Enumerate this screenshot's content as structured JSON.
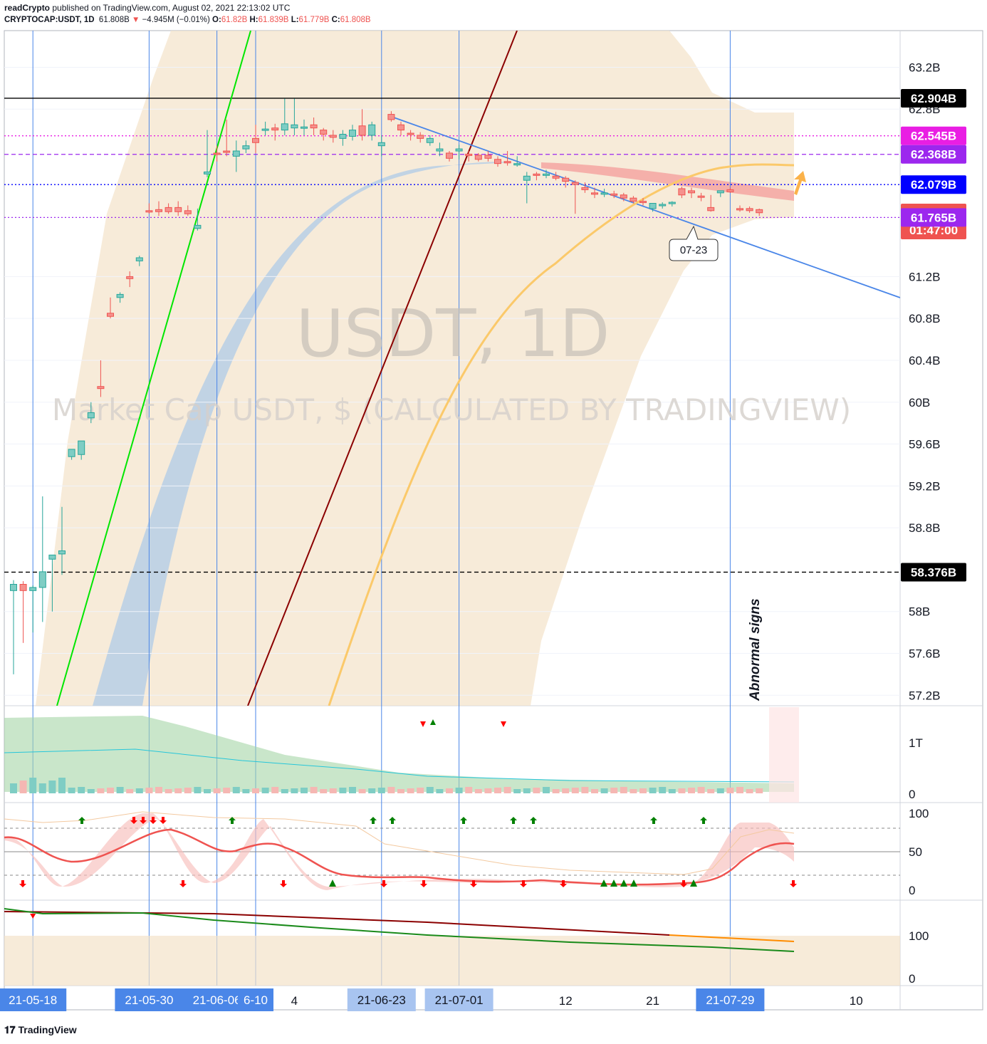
{
  "header": {
    "publisher": "readCrypto",
    "published_text": "published on TradingView.com, August 02, 2021 22:13:02 UTC",
    "symbol": "CRYPTOCAP:USDT, 1D",
    "last": "61.808B",
    "change_arrow": "▼",
    "change": "−4.945M (−0.01%)",
    "o_label": "O:",
    "o": "61.82B",
    "h_label": "H:",
    "h": "61.839B",
    "l_label": "L:",
    "l": "61.779B",
    "c_label": "C:",
    "c": "61.808B"
  },
  "watermark": {
    "main": "USDT, 1D",
    "sub": "Market Cap USDT, $ (CALCULATED BY TRADINGVIEW)"
  },
  "annotations": {
    "callout": "07-23",
    "vertical_text": "Abnormal signs"
  },
  "footer": {
    "brand": "TradingView"
  },
  "colors": {
    "up": "#26a69a",
    "down": "#ef5350",
    "trend_blue": "#4a86e8",
    "green_line": "#00e600",
    "dark_red_line": "#8b0000",
    "orange_ma": "#fbc96a",
    "cloud": "#f3e2c9",
    "blue_band": "#b3cde6",
    "magenta": "#e91ee3",
    "purple": "#9c27ee",
    "blue_label": "#0000ff"
  },
  "chart_data": {
    "type": "candlestick",
    "symbol": "CRYPTOCAP:USDT",
    "interval": "1D",
    "y_unit": "B",
    "ylim": [
      57.1,
      63.55
    ],
    "y_ticks": [
      "63.2B",
      "62.8B",
      "61.2B",
      "60.8B",
      "60.4B",
      "60B",
      "59.6B",
      "59.2B",
      "58.8B",
      "58B",
      "57.6B",
      "57.2B"
    ],
    "y_tick_values": [
      63.2,
      62.8,
      61.2,
      60.8,
      60.4,
      60.0,
      59.6,
      59.2,
      58.8,
      58.0,
      57.6,
      57.2
    ],
    "x_ticks": [
      "4",
      "12",
      "21",
      "10"
    ],
    "x_tick_index": [
      29,
      57,
      66,
      87
    ],
    "date_badges": [
      "21-05-18",
      "21-05-30",
      "21-06-06",
      "6-10",
      "21-06-23",
      "21-07-01",
      "21-07-29"
    ],
    "date_badge_index": [
      2,
      14,
      21,
      25,
      38,
      46,
      74
    ],
    "price_labels": [
      {
        "text": "62.904B",
        "value": 62.904,
        "color": "#000000",
        "line": "solid"
      },
      {
        "text": "62.545B",
        "value": 62.545,
        "color": "#e91ee3",
        "line": "dotted"
      },
      {
        "text": "62.368B",
        "value": 62.368,
        "color": "#9c27ee",
        "line": "dashed"
      },
      {
        "text": "62.079B",
        "value": 62.079,
        "color": "#0000ff",
        "line": "dotted"
      },
      {
        "text": "61.808B",
        "value": 61.808,
        "color": "#ef5350",
        "line": "none"
      },
      {
        "text": "01:47:00",
        "value": 61.808,
        "color": "#ef5350",
        "line": "none"
      },
      {
        "text": "61.765B",
        "value": 61.765,
        "color": "#9c27ee",
        "line": "dotted"
      },
      {
        "text": "58.376B",
        "value": 58.376,
        "color": "#000000",
        "line": "dashed"
      }
    ],
    "candles": [
      [
        58.2,
        58.3,
        57.4,
        58.26
      ],
      [
        58.26,
        58.29,
        57.7,
        58.2
      ],
      [
        58.2,
        58.25,
        57.8,
        58.23
      ],
      [
        58.23,
        59.1,
        57.9,
        58.38
      ],
      [
        58.5,
        58.54,
        58.0,
        58.54
      ],
      [
        58.55,
        59.0,
        58.35,
        58.58
      ],
      [
        59.48,
        59.55,
        59.45,
        59.55
      ],
      [
        59.5,
        59.58,
        59.45,
        59.63
      ],
      [
        59.85,
        60.0,
        59.8,
        59.9
      ],
      [
        60.15,
        60.4,
        60.05,
        60.13
      ],
      [
        60.85,
        61.0,
        60.8,
        60.82
      ],
      [
        61.0,
        61.05,
        60.95,
        61.03
      ],
      [
        61.2,
        61.25,
        61.1,
        61.18
      ],
      [
        61.35,
        61.4,
        61.3,
        61.38
      ],
      [
        61.83,
        61.9,
        61.8,
        61.82
      ],
      [
        61.84,
        61.92,
        61.78,
        61.82
      ],
      [
        61.86,
        61.9,
        61.8,
        61.82
      ],
      [
        61.86,
        61.92,
        61.78,
        61.82
      ],
      [
        61.83,
        61.88,
        61.78,
        61.8
      ],
      [
        61.66,
        61.85,
        61.64,
        61.69
      ],
      [
        62.18,
        62.6,
        62.15,
        62.2
      ],
      [
        62.38,
        62.45,
        62.3,
        62.37
      ],
      [
        62.4,
        62.7,
        62.35,
        62.39
      ],
      [
        62.35,
        62.5,
        62.2,
        62.4
      ],
      [
        62.42,
        62.5,
        62.38,
        62.45
      ],
      [
        62.52,
        62.65,
        62.38,
        62.48
      ],
      [
        62.6,
        62.68,
        62.55,
        62.61
      ],
      [
        62.62,
        62.66,
        62.5,
        62.6
      ],
      [
        62.6,
        62.9,
        62.55,
        62.66
      ],
      [
        62.62,
        62.9,
        62.55,
        62.65
      ],
      [
        62.63,
        62.7,
        62.55,
        62.63
      ],
      [
        62.65,
        62.72,
        62.55,
        62.62
      ],
      [
        62.6,
        62.62,
        62.5,
        62.56
      ],
      [
        62.55,
        62.6,
        62.48,
        62.53
      ],
      [
        62.52,
        62.6,
        62.45,
        62.56
      ],
      [
        62.54,
        62.65,
        62.5,
        62.6
      ],
      [
        62.64,
        62.8,
        62.5,
        62.55
      ],
      [
        62.55,
        62.68,
        62.5,
        62.65
      ],
      [
        62.45,
        62.55,
        62.35,
        62.48
      ],
      [
        62.75,
        62.78,
        62.68,
        62.7
      ],
      [
        62.65,
        62.68,
        62.55,
        62.6
      ],
      [
        62.57,
        62.6,
        62.5,
        62.56
      ],
      [
        62.55,
        62.58,
        62.48,
        62.52
      ],
      [
        62.48,
        62.55,
        62.45,
        62.52
      ],
      [
        62.4,
        62.48,
        62.35,
        62.42
      ],
      [
        62.38,
        62.4,
        62.3,
        62.33
      ],
      [
        62.4,
        62.46,
        62.32,
        62.42
      ],
      [
        62.37,
        62.4,
        62.3,
        62.36
      ],
      [
        62.36,
        62.38,
        62.3,
        62.32
      ],
      [
        62.36,
        62.4,
        62.3,
        62.33
      ],
      [
        62.32,
        62.35,
        62.25,
        62.28
      ],
      [
        62.3,
        62.4,
        62.26,
        62.29
      ],
      [
        62.28,
        62.35,
        62.25,
        62.28
      ],
      [
        62.12,
        62.2,
        61.9,
        62.16
      ],
      [
        62.18,
        62.2,
        62.12,
        62.17
      ],
      [
        62.17,
        62.22,
        62.14,
        62.18
      ],
      [
        62.16,
        62.2,
        62.12,
        62.14
      ],
      [
        62.14,
        62.16,
        62.05,
        62.11
      ],
      [
        62.1,
        62.12,
        61.8,
        62.08
      ],
      [
        62.05,
        62.1,
        62.0,
        62.03
      ],
      [
        62.0,
        62.05,
        61.95,
        61.99
      ],
      [
        62.0,
        62.04,
        61.96,
        62.0
      ],
      [
        61.99,
        62.02,
        61.95,
        61.98
      ],
      [
        61.98,
        62.0,
        61.92,
        61.95
      ],
      [
        61.95,
        61.97,
        61.9,
        61.92
      ],
      [
        61.92,
        61.95,
        61.88,
        61.91
      ],
      [
        61.85,
        61.9,
        61.82,
        61.9
      ],
      [
        61.88,
        61.91,
        61.85,
        61.89
      ],
      [
        61.9,
        61.92,
        61.87,
        61.91
      ],
      [
        62.04,
        62.06,
        61.95,
        61.98
      ],
      [
        62.02,
        62.05,
        61.95,
        62.0
      ],
      [
        61.97,
        62.0,
        61.92,
        61.96
      ],
      [
        61.86,
        61.98,
        61.82,
        61.83
      ],
      [
        62.0,
        62.02,
        61.96,
        62.02
      ],
      [
        62.03,
        62.05,
        62.0,
        62.01
      ],
      [
        61.85,
        61.88,
        61.82,
        61.84
      ],
      [
        61.85,
        61.87,
        61.81,
        61.83
      ],
      [
        61.84,
        61.85,
        61.78,
        61.81
      ]
    ]
  }
}
